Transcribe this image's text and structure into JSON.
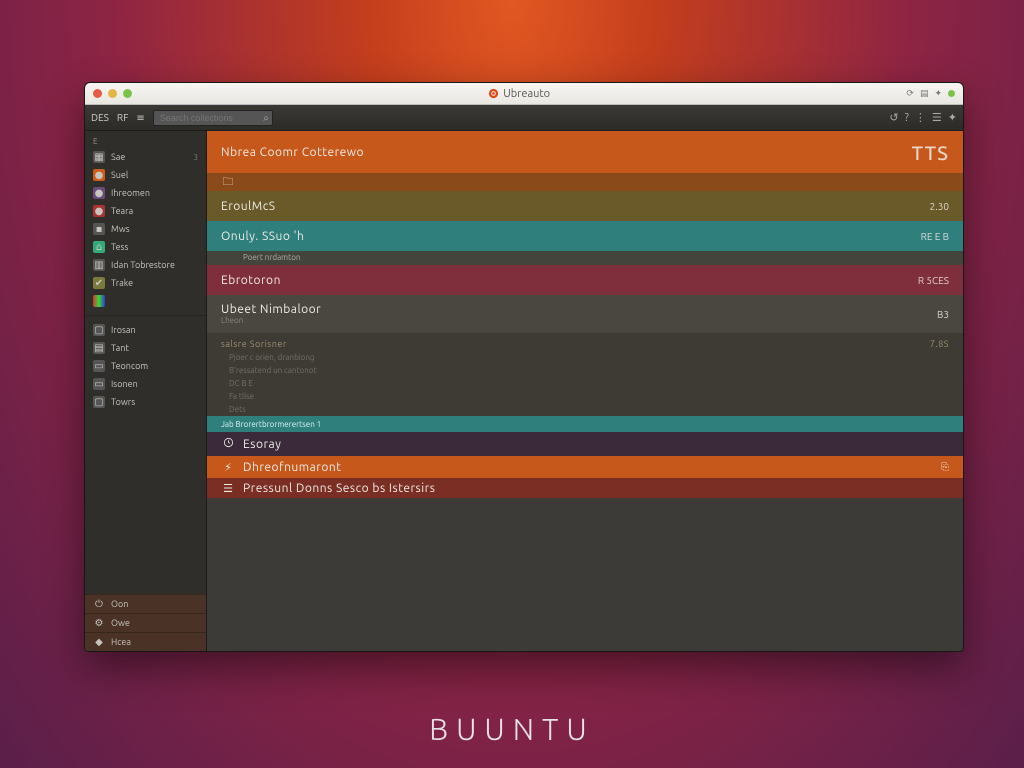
{
  "desktop": {
    "label": "BUUNTU"
  },
  "titlebar": {
    "title": "Ubreauto"
  },
  "menubar": {
    "items": [
      "DES",
      "RF",
      "≡"
    ],
    "search_placeholder": "Search collections",
    "right_icons": [
      "↺",
      "?",
      "⋮",
      "☰",
      "✦"
    ]
  },
  "sidebar": {
    "top_head": "E",
    "top": [
      {
        "icon": "ic-box",
        "glyph": "▦",
        "label": "Sae",
        "tag": "3"
      },
      {
        "icon": "ic-or",
        "glyph": "●",
        "label": "Suel"
      },
      {
        "icon": "ic-pu",
        "glyph": "●",
        "label": "Ihreomen"
      },
      {
        "icon": "ic-rd",
        "glyph": "●",
        "label": "Teara"
      },
      {
        "icon": "ic-box",
        "glyph": "▪",
        "label": "Mws"
      },
      {
        "icon": "ic-gr",
        "glyph": "⌂",
        "label": "Tess"
      },
      {
        "icon": "ic-box",
        "glyph": "▥",
        "label": "Idan Tobrestore"
      },
      {
        "icon": "ic-ol",
        "glyph": "✔",
        "label": "Trake"
      },
      {
        "icon": "ic-bar",
        "glyph": " ",
        "label": ""
      }
    ],
    "mid_head": "",
    "mid": [
      {
        "icon": "ic-box",
        "glyph": "▢",
        "label": "Irosan"
      },
      {
        "icon": "ic-box",
        "glyph": "▤",
        "label": "Tant"
      },
      {
        "icon": "ic-box",
        "glyph": "▭",
        "label": "Teoncom"
      },
      {
        "icon": "ic-box",
        "glyph": "▭",
        "label": "Isonen"
      },
      {
        "icon": "ic-box",
        "glyph": "▢",
        "label": "Towrs"
      }
    ],
    "low": [
      {
        "icon": "",
        "glyph": "⏻",
        "label": "Oon"
      },
      {
        "icon": "",
        "glyph": "⚙",
        "label": "Owe"
      },
      {
        "icon": "",
        "glyph": "◆",
        "label": "Hcea"
      }
    ]
  },
  "rows": {
    "r0": {
      "title": "Nbrea Coomr Cotterewo",
      "meta": "TTS",
      "sub_icon": "🗀"
    },
    "r1": {
      "title": "EroulMcS",
      "meta": "2.30"
    },
    "r2": {
      "title": "Onuly. SSuo 'h",
      "meta": "RE E B",
      "sub": "Poert nrdamton"
    },
    "r3": {
      "title": "Ebrotoron",
      "meta": "R 5CES"
    },
    "r4": {
      "title": "Ubeet Nimbaloor",
      "meta": "B3",
      "sub": "Lheon"
    },
    "r5": {
      "head_left": "salsre Sorisner",
      "head_right": "7.8S",
      "lines": [
        "Pjoer c orien, dranbiong",
        "B'ressatend un cantonot",
        "DC B E",
        "Fa tllse",
        "Dets"
      ]
    },
    "r6": {
      "text": "Jab Brorertbrormerertsen   1"
    },
    "r7": {
      "icon": "clock",
      "title": "Esoray"
    },
    "r8": {
      "icon": "⚡",
      "title": "Dhreofnumaront",
      "meta": "⎘"
    },
    "r9": {
      "icon": "☰",
      "title": "Pressunl Donns Sesco bs Istersirs"
    }
  }
}
